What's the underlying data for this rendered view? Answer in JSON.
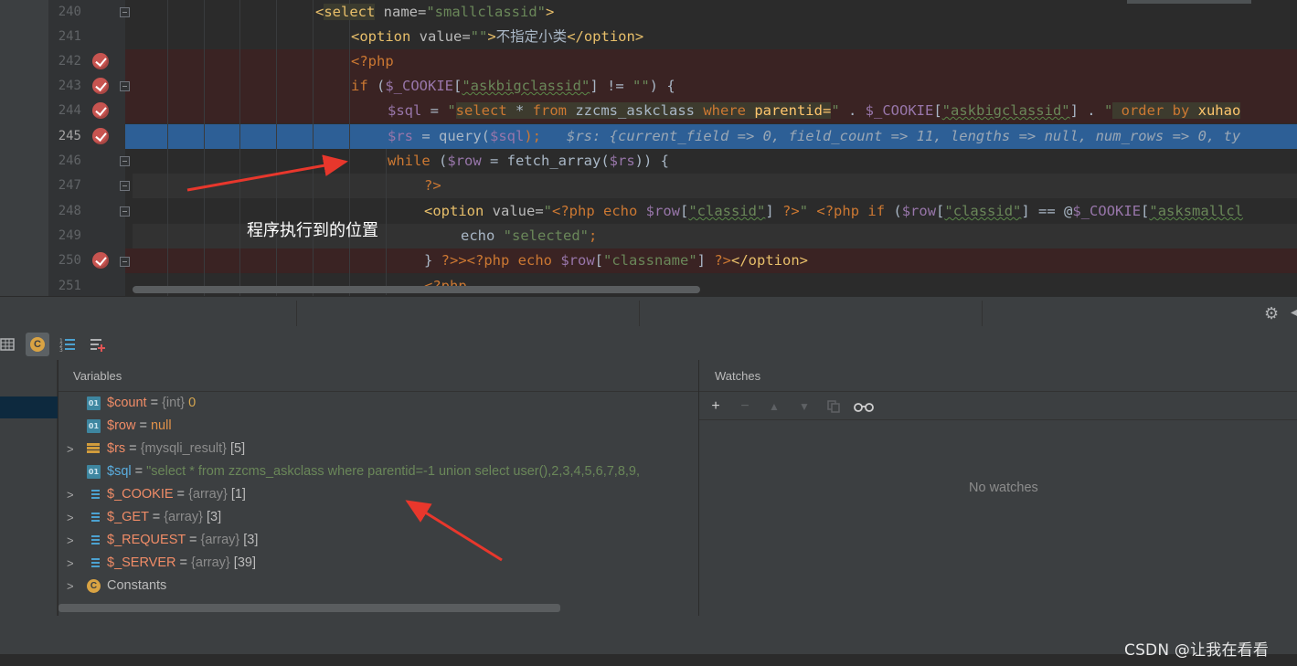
{
  "editor": {
    "lines": [
      {
        "num": "240"
      },
      {
        "num": "241"
      },
      {
        "num": "242"
      },
      {
        "num": "243"
      },
      {
        "num": "244"
      },
      {
        "num": "245"
      },
      {
        "num": "246"
      },
      {
        "num": "247"
      },
      {
        "num": "248"
      },
      {
        "num": "249"
      },
      {
        "num": "250"
      },
      {
        "num": "251"
      }
    ],
    "code": {
      "l240": {
        "a": "<",
        "b": "select",
        "c": " name=",
        "d": "\"smallclassid\"",
        "e": ">"
      },
      "l241": {
        "a": "<option",
        "b": " value=",
        "c": "\"\"",
        "d": ">",
        "e": "不指定小类",
        "f": "</option>"
      },
      "l242": {
        "a": "<?php"
      },
      "l243": {
        "a": "if",
        "b": " (",
        "c": "$_COOKIE",
        "d": "[",
        "e": "\"askbigclassid\"",
        "f": "] != ",
        "g": "\"\"",
        "h": ") {"
      },
      "l244": {
        "a": "$sql",
        "b": " = ",
        "c": "\"",
        "d": "select",
        "e": " * ",
        "f": "from",
        "g": " zzcms_askclass ",
        "h": "where",
        "i": " parentid=",
        "j": "\"",
        "k": " . ",
        "l": "$_COOKIE",
        "m": "[",
        "n": "\"askbigclassid\"",
        "o": "] . ",
        "p": "\"",
        "q": " order by",
        "r": " xuhao"
      },
      "l245": {
        "a": "$rs",
        "b": " = ",
        "c": "query",
        "d": "(",
        "e": "$sql",
        "f": ");",
        "g": "   $rs: {current_field => 0, field_count => 11, lengths => null, num_rows => 0, ty"
      },
      "l246": {
        "a": "while",
        "b": " (",
        "c": "$row",
        "d": " = ",
        "e": "fetch_array",
        "f": "(",
        "g": "$rs",
        "h": ")) {"
      },
      "l247": {
        "a": "?>"
      },
      "l248": {
        "a": "<option",
        "b": " value=",
        "c": "\"",
        "d": "<?php",
        "e": " echo ",
        "f": "$row",
        "g": "[",
        "h": "\"classid\"",
        "i": "] ",
        "j": "?>",
        "k": "\"",
        "l": " <?php",
        "m": " if ",
        "n": "(",
        "o": "$row",
        "p": "[",
        "q": "\"classid\"",
        "r": "] == @",
        "s": "$_COOKIE",
        "t": "[",
        "u": "\"asksmallcl"
      },
      "l249": {
        "a": "echo ",
        "b": "\"selected\"",
        "c": ";"
      },
      "l250": {
        "a": "} ",
        "b": "?>",
        "c": "><?php",
        "d": " echo ",
        "e": "$row",
        "f": "[",
        "g": "\"classname\"",
        "h": "] ",
        "i": "?>",
        "j": "</option>"
      },
      "l251": {
        "a": "<?php"
      }
    }
  },
  "annotation": {
    "text": "程序执行到的位置"
  },
  "debug": {
    "toolbar": {
      "icons": [
        "table-icon",
        "constants-icon",
        "list-icon",
        "add-watch-list-icon"
      ]
    },
    "variables": {
      "title": "Variables",
      "rows": [
        {
          "name": "$count",
          "eq": " = ",
          "type": "{int}",
          "value": " 0"
        },
        {
          "name": "$row",
          "eq": " = ",
          "value": "null"
        },
        {
          "name": "$rs",
          "eq": " = ",
          "type": "{mysqli_result}",
          "value": " [5]"
        },
        {
          "name": "$sql",
          "eq": " = ",
          "value": "\"select * from zzcms_askclass where parentid=-1 union select user(),2,3,4,5,6,7,8,9,"
        },
        {
          "name": "$_COOKIE",
          "eq": " = ",
          "type": "{array}",
          "value": " [1]"
        },
        {
          "name": "$_GET",
          "eq": " = ",
          "type": "{array}",
          "value": " [3]"
        },
        {
          "name": "$_REQUEST",
          "eq": " = ",
          "type": "{array}",
          "value": " [3]"
        },
        {
          "name": "$_SERVER",
          "eq": " = ",
          "type": "{array}",
          "value": " [39]"
        },
        {
          "name": "Constants"
        }
      ]
    },
    "watches": {
      "title": "Watches",
      "empty_text": "No watches"
    }
  },
  "watermark": "CSDN @让我在看看",
  "colors": {
    "breakpoint": "#c75450",
    "exec_line": "#2d5f96",
    "arrow": "#e8372c"
  }
}
